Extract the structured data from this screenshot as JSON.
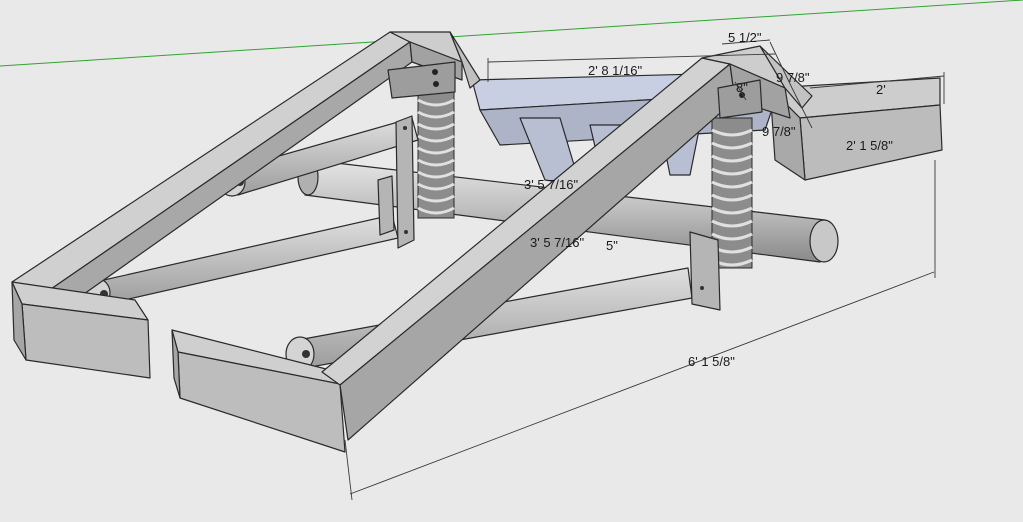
{
  "dimensions": {
    "overall_length": "6' 1 5/8\"",
    "crossmember_width": "2' 8 1/16\"",
    "axle_length": "3' 5 7/16\"",
    "lower_span": "3' 5 7/16\"",
    "small_offset": "5\"",
    "top_width": "5 1/2\"",
    "height_upper": "9 7/8\"",
    "height_lower": "9 7/8\"",
    "bracket": "8\"",
    "rear_width": "2'",
    "rear_depth": "2' 1 5/8\""
  },
  "colors": {
    "background": "#e9e9e9",
    "frame_top": "#cfcfcf",
    "frame_side": "#a9a9a9",
    "frame_face": "#bdbdbd",
    "crossmember": "#c9cfe2",
    "horizon_line": "#2fa52f",
    "tube": "#c4c4c4",
    "spring": "#8c8c8c"
  }
}
